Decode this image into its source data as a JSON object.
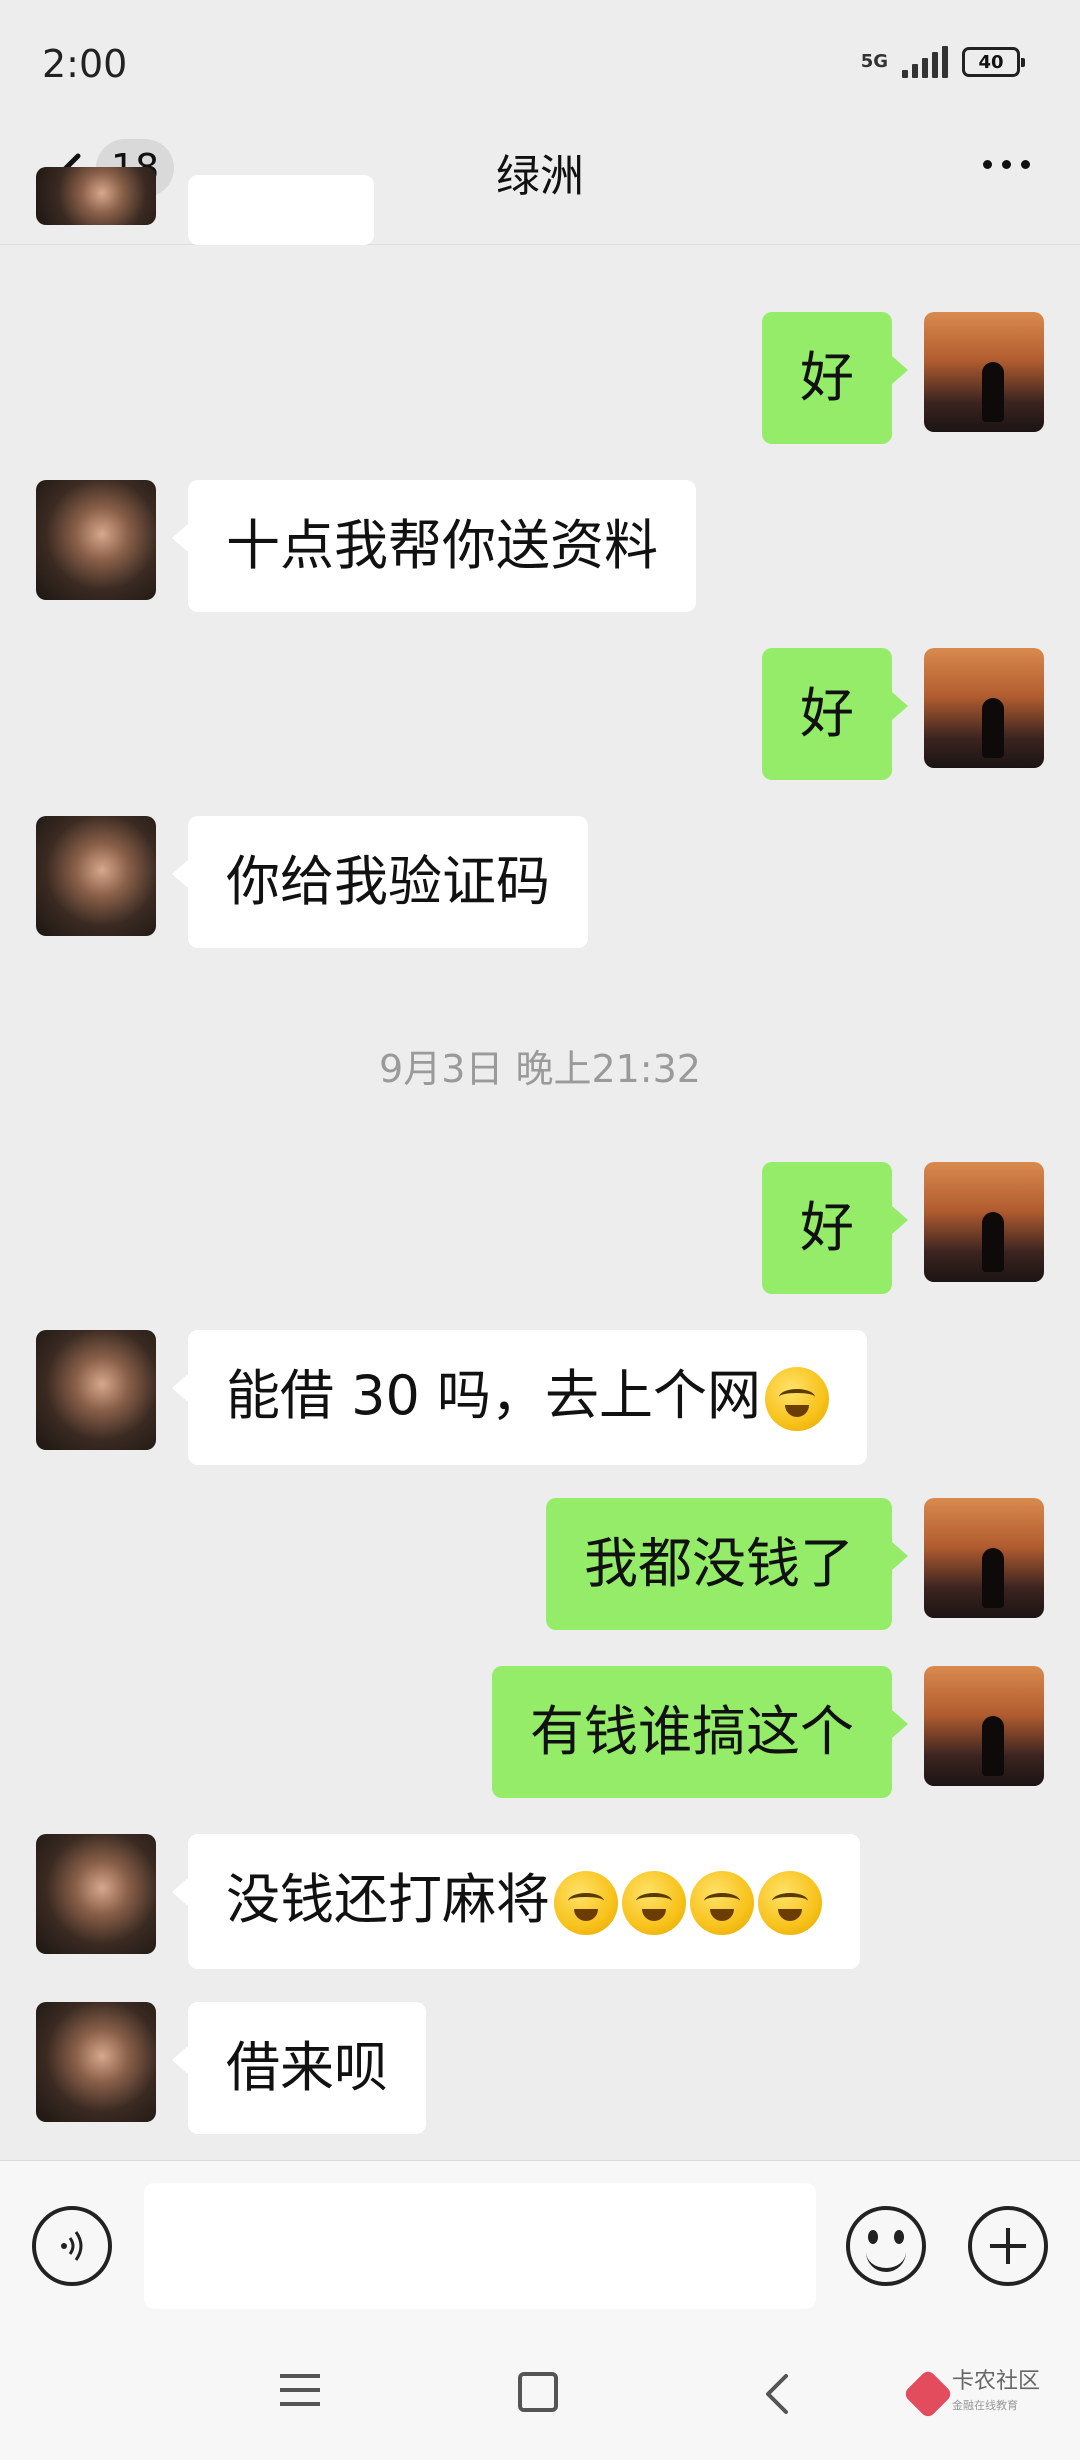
{
  "status_bar": {
    "time": "2:00",
    "network": "5G",
    "battery": "40"
  },
  "header": {
    "unread_count": "18",
    "title": "绿洲"
  },
  "messages": [
    {
      "from": "self",
      "text": "好"
    },
    {
      "from": "friend",
      "text": "十点我帮你送资料"
    },
    {
      "from": "self",
      "text": "好"
    },
    {
      "from": "friend",
      "text": "你给我验证码"
    },
    {
      "from": "self",
      "text": "好"
    },
    {
      "from": "friend",
      "text": "能借 30 吗，去上个网",
      "emoji": "face-with-tears-of-joy",
      "emoji_count": 1
    },
    {
      "from": "self",
      "text": "我都没钱了"
    },
    {
      "from": "self",
      "text": "有钱谁搞这个"
    },
    {
      "from": "friend",
      "text": "没钱还打麻将",
      "emoji": "face-with-tears-of-joy",
      "emoji_count": 4
    },
    {
      "from": "friend",
      "text": "借来呗"
    }
  ],
  "timestamp": "9月3日 晚上21:32",
  "input": {
    "value": ""
  },
  "watermark": {
    "name": "卡农社区",
    "tagline": "金融在线教育"
  },
  "colors": {
    "background": "#ededed",
    "self_bubble": "#95ec69",
    "friend_bubble": "#ffffff",
    "timestamp": "#9a9a9a"
  }
}
